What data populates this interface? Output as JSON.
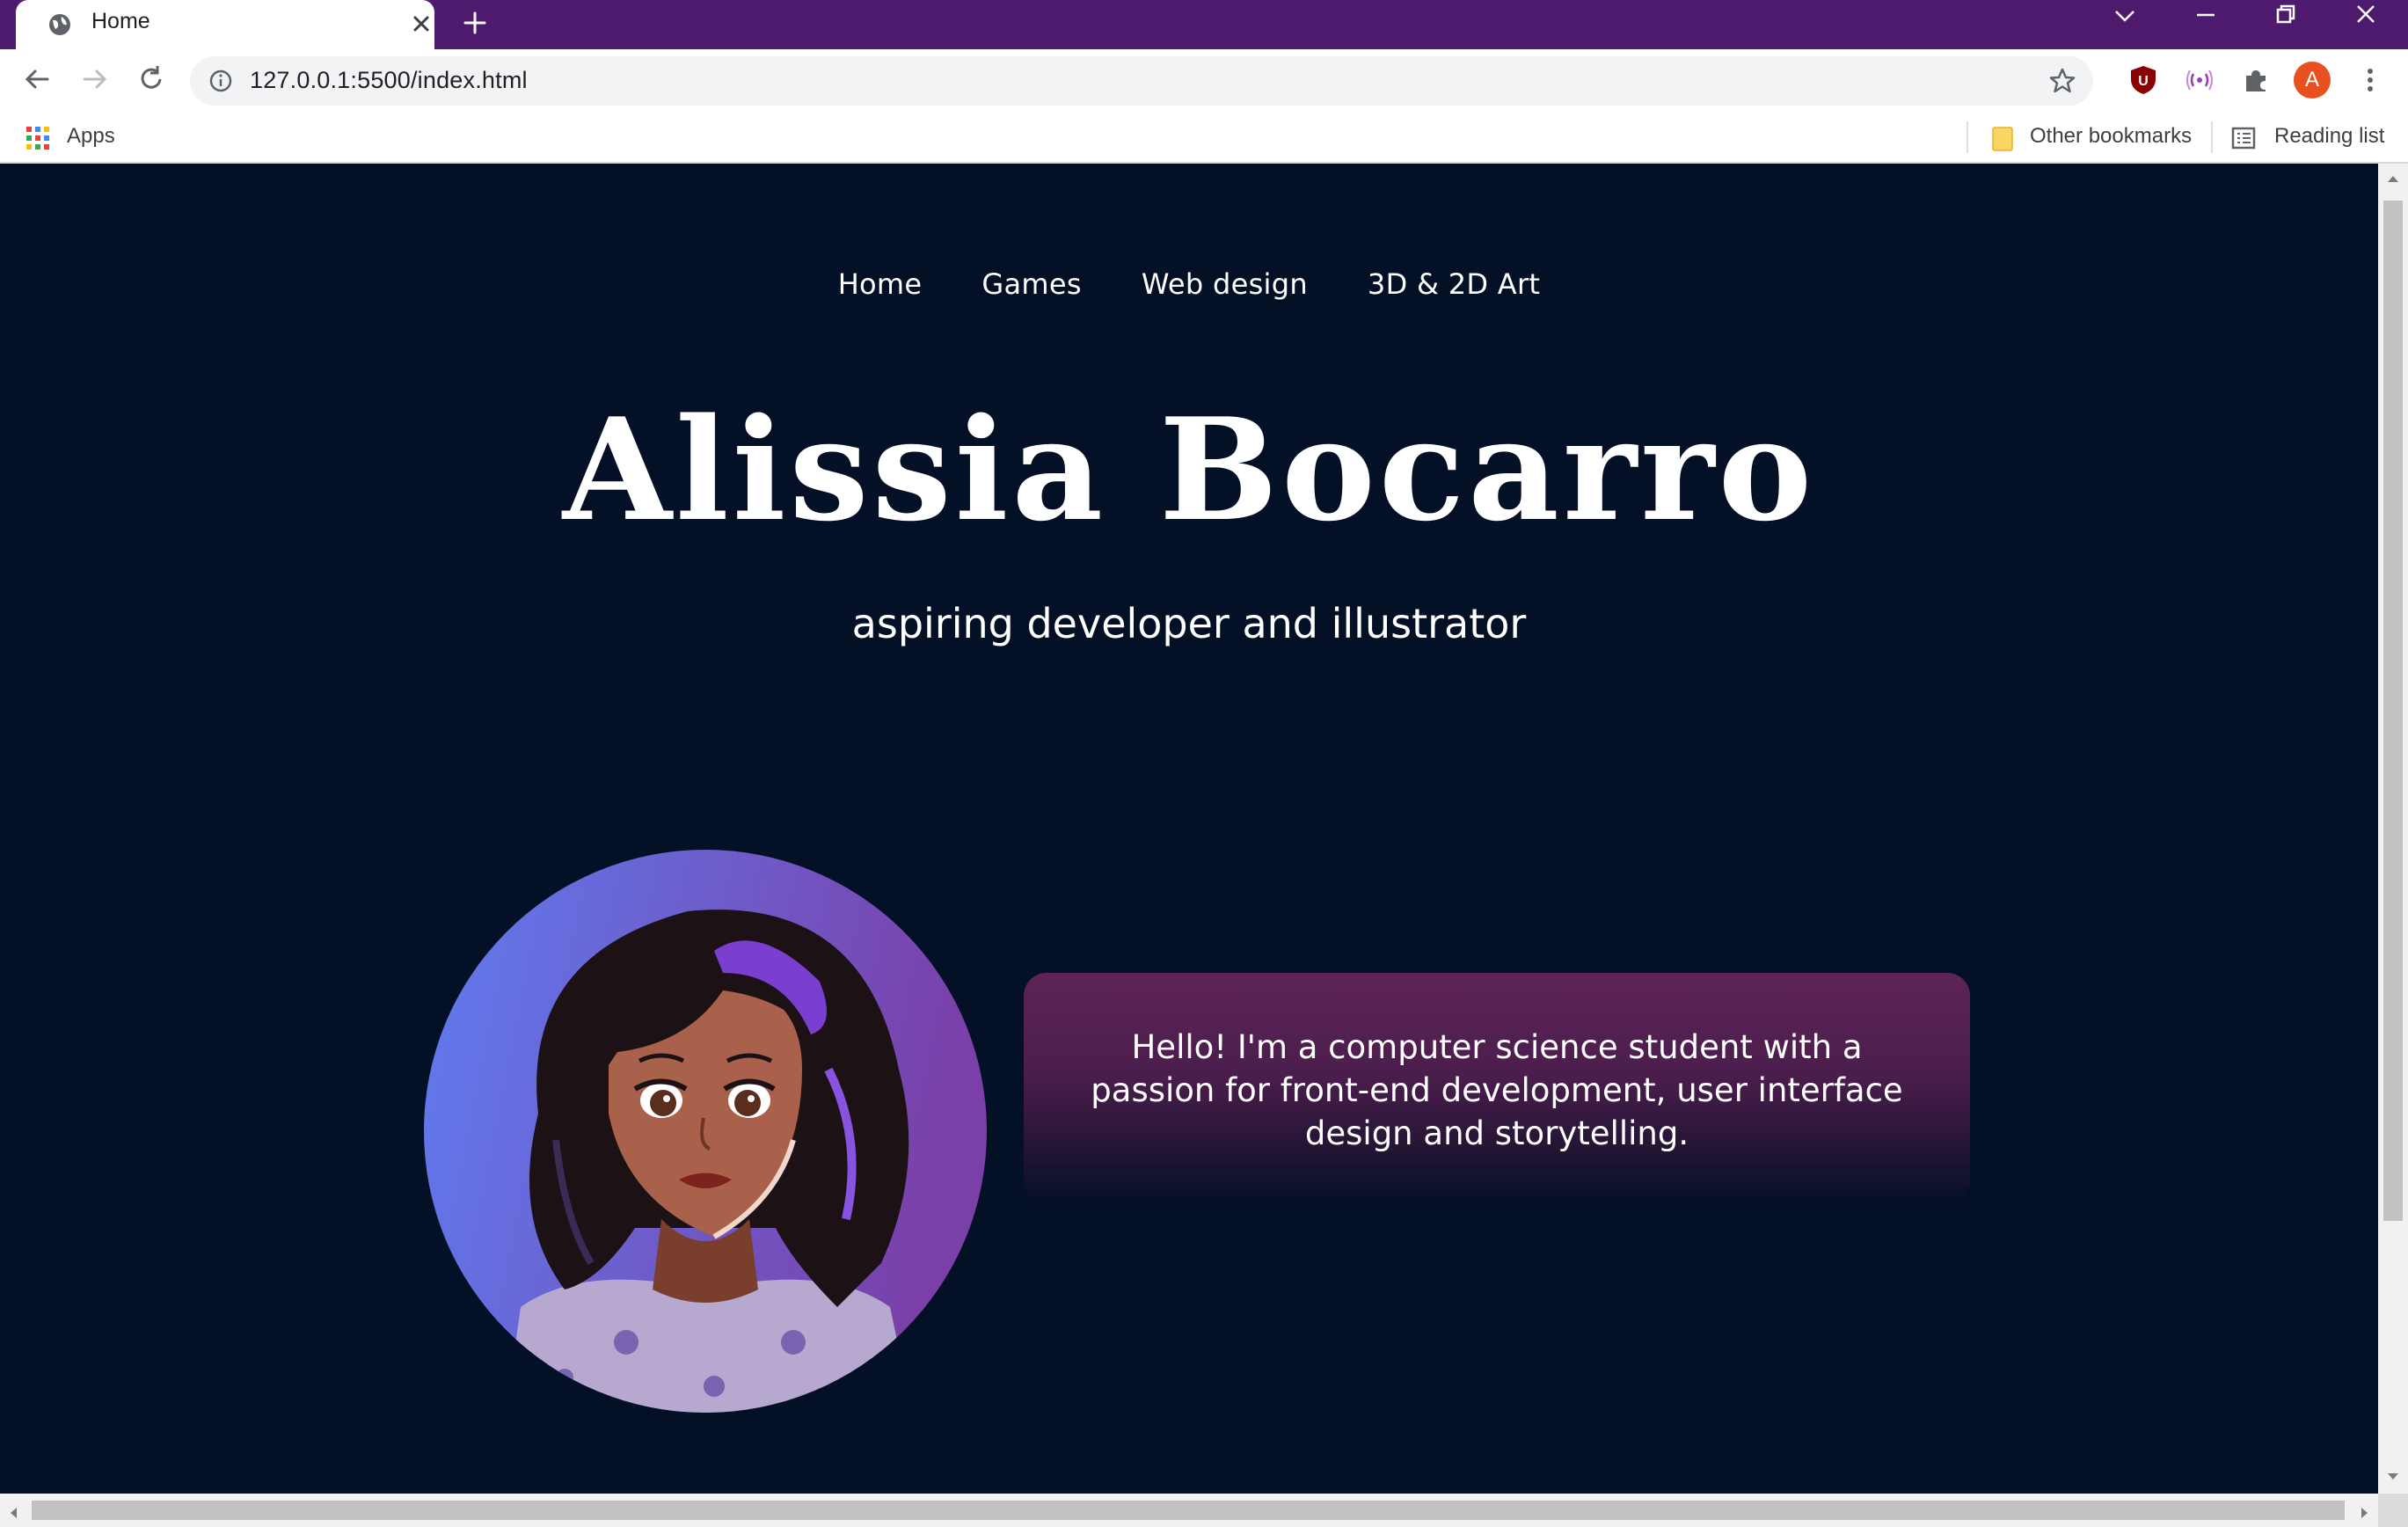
{
  "browser": {
    "tab_title": "Home",
    "url": "127.0.0.1:5500/index.html",
    "profile_initial": "A",
    "ext_ublock_letter": "U",
    "bookmarks": {
      "apps_label": "Apps",
      "other_label": "Other bookmarks",
      "reading_list_label": "Reading list"
    },
    "colors": {
      "tabbar": "#4d1a6e",
      "profile": "#e8511f",
      "ublock": "#8b0000"
    }
  },
  "site": {
    "nav": [
      "Home",
      "Games",
      "Web design",
      "3D & 2D Art"
    ],
    "name": "Alissia Bocarro",
    "tagline": "aspiring developer and illustrator",
    "intro": "Hello! I'm a computer science student with a passion for front-end development, user interface design and storytelling.",
    "colors": {
      "background": "#041025",
      "card_top": "#5e2458",
      "avatar_gradient": [
        "#5f7cf0",
        "#7b3fa8"
      ]
    }
  }
}
